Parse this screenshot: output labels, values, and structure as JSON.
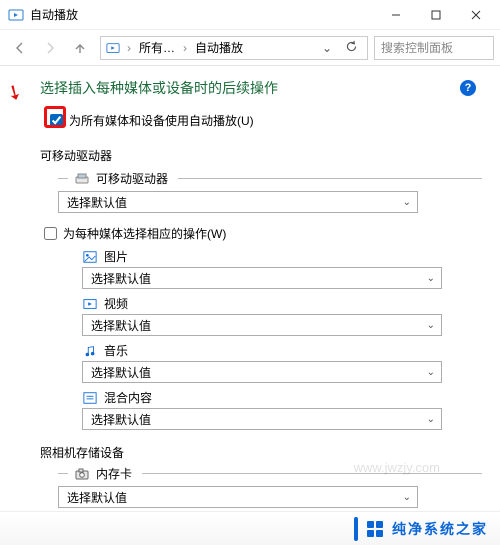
{
  "titlebar": {
    "icon": "autoplay-icon",
    "title": "自动播放"
  },
  "nav": {
    "crumb_root": "所有…",
    "crumb_leaf": "自动播放",
    "search_placeholder": "搜索控制面板"
  },
  "page": {
    "heading": "选择插入每种媒体或设备时的后续操作",
    "help_icon_label": "?"
  },
  "master_checkbox": {
    "checked": true,
    "label": "为所有媒体和设备使用自动播放(U)"
  },
  "section_removable": {
    "title": "可移动驱动器",
    "group_label": "可移动驱动器",
    "select_value": "选择默认值"
  },
  "section_media": {
    "checkbox_label": "为每种媒体选择相应的操作(W)",
    "checkbox_checked": false,
    "items": [
      {
        "key": "pictures",
        "icon": "image-icon",
        "label": "图片",
        "select_value": "选择默认值"
      },
      {
        "key": "videos",
        "icon": "video-icon",
        "label": "视频",
        "select_value": "选择默认值"
      },
      {
        "key": "music",
        "icon": "music-icon",
        "label": "音乐",
        "select_value": "选择默认值"
      },
      {
        "key": "mixed",
        "icon": "mixed-icon",
        "label": "混合内容",
        "select_value": "选择默认值"
      }
    ]
  },
  "section_camera": {
    "title": "照相机存储设备",
    "group_label": "内存卡",
    "select_value": "选择默认值"
  },
  "watermark": {
    "text": "纯净系统之家",
    "url": "www.jwzjy.com"
  }
}
